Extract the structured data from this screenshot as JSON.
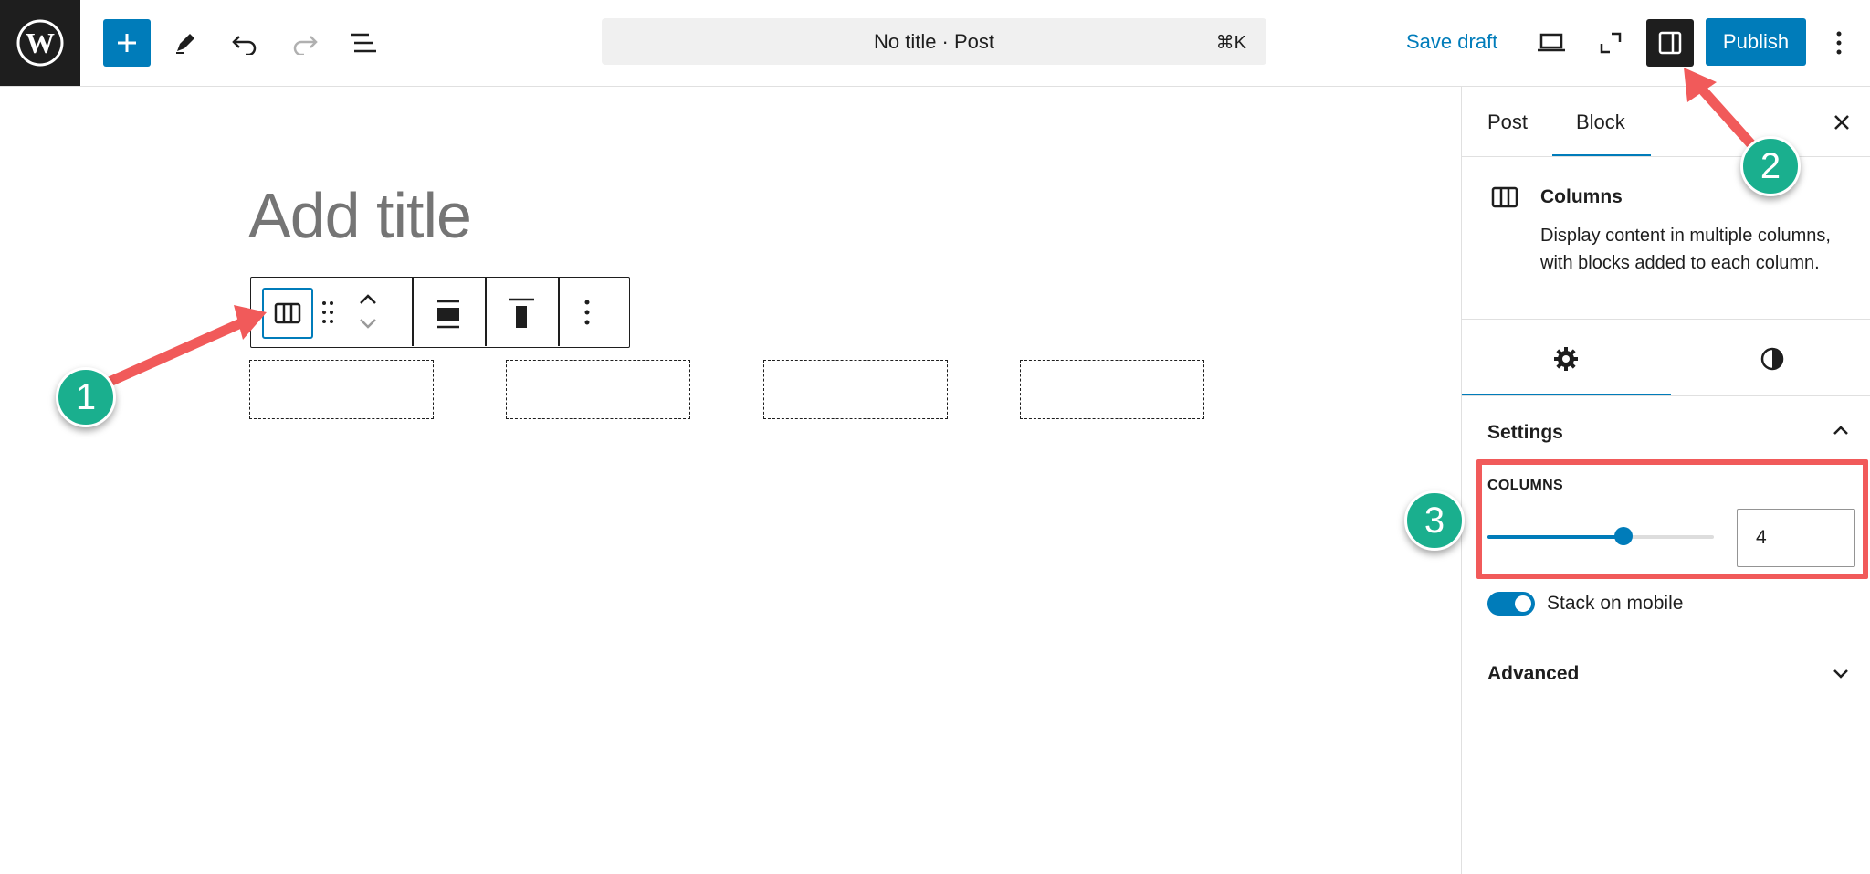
{
  "topbar": {
    "command_bar_text": "No title · Post",
    "command_shortcut": "⌘K",
    "save_draft_label": "Save draft",
    "publish_label": "Publish"
  },
  "editor": {
    "title_placeholder": "Add title",
    "column_count": 4
  },
  "sidebar": {
    "tabs": [
      {
        "label": "Post"
      },
      {
        "label": "Block",
        "active": true
      }
    ],
    "block": {
      "name": "Columns",
      "description": "Display content in multiple columns, with blocks added to each column."
    },
    "settings": {
      "title": "Settings",
      "columns_label": "COLUMNS",
      "columns_value": "4",
      "columns_slider_fraction": 0.6,
      "stack_on_mobile_label": "Stack on mobile",
      "stack_on_mobile_on": true
    },
    "advanced_title": "Advanced"
  },
  "annotations": {
    "badges": [
      "1",
      "2",
      "3"
    ],
    "color": "#f15a5a",
    "badge_color": "#1aaf8e"
  },
  "colors": {
    "accent": "#007cba",
    "dark": "#1e1e1e"
  }
}
